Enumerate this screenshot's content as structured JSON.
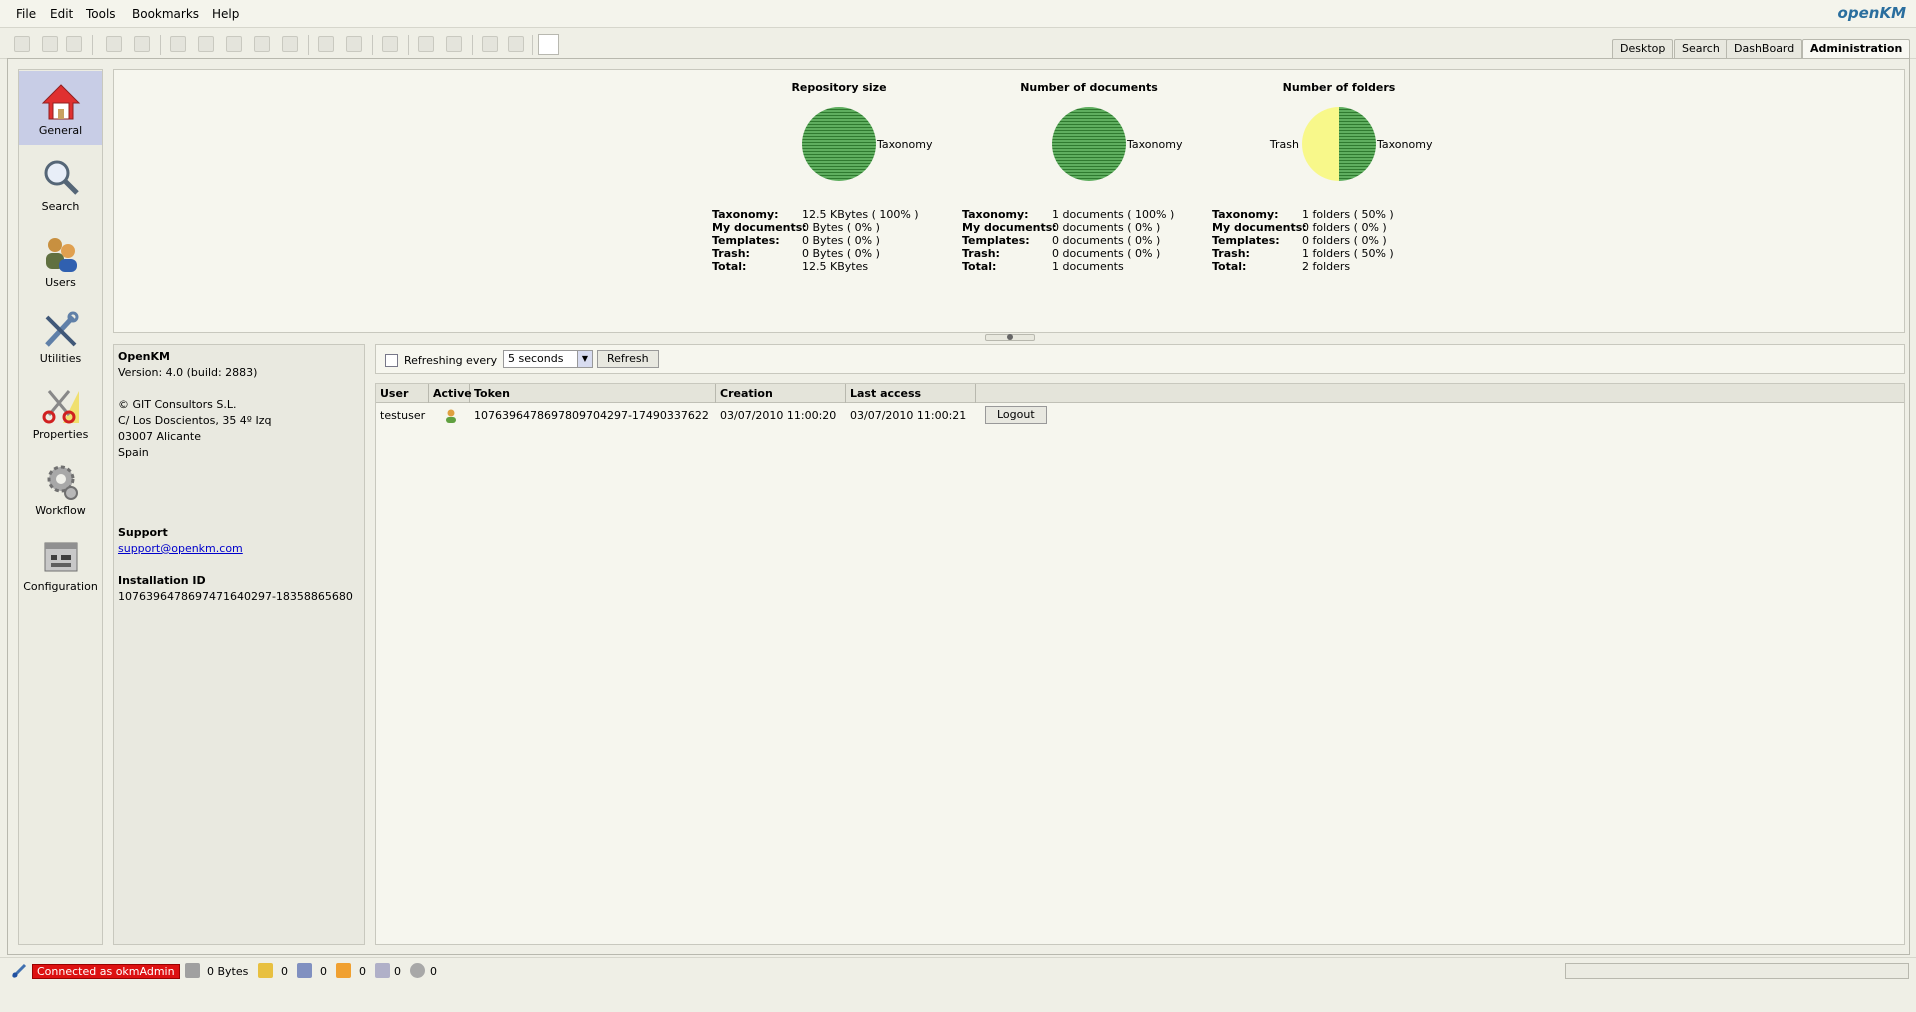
{
  "menu": [
    "File",
    "Edit",
    "Tools",
    "Bookmarks",
    "Help"
  ],
  "logo": {
    "main": "openKM"
  },
  "tabs": [
    "Desktop",
    "Search",
    "DashBoard",
    "Administration"
  ],
  "active_tab": "Administration",
  "nav": [
    {
      "label": "General",
      "icon": "home-icon",
      "active": true
    },
    {
      "label": "Search",
      "icon": "magnifier-icon"
    },
    {
      "label": "Users",
      "icon": "users-icon"
    },
    {
      "label": "Utilities",
      "icon": "tools-icon"
    },
    {
      "label": "Properties",
      "icon": "scissors-icon"
    },
    {
      "label": "Workflow",
      "icon": "gears-icon"
    },
    {
      "label": "Configuration",
      "icon": "server-icon"
    }
  ],
  "stats": [
    {
      "title": "Repository size",
      "pie": [
        {
          "label": "Taxonomy",
          "value": 100,
          "color": "#5fae5f"
        }
      ],
      "rows": [
        {
          "label": "Taxonomy:",
          "value": "12.5 KBytes ( 100% )"
        },
        {
          "label": "My documents:",
          "value": "0 Bytes ( 0% )"
        },
        {
          "label": "Templates:",
          "value": "0 Bytes ( 0% )"
        },
        {
          "label": "Trash:",
          "value": "0 Bytes ( 0% )"
        },
        {
          "label": "Total:",
          "value": "12.5 KBytes"
        }
      ]
    },
    {
      "title": "Number of documents",
      "pie": [
        {
          "label": "Taxonomy",
          "value": 100,
          "color": "#5fae5f"
        }
      ],
      "rows": [
        {
          "label": "Taxonomy:",
          "value": "1 documents ( 100% )"
        },
        {
          "label": "My documents:",
          "value": "0 documents ( 0% )"
        },
        {
          "label": "Templates:",
          "value": "0 documents ( 0% )"
        },
        {
          "label": "Trash:",
          "value": "0 documents ( 0% )"
        },
        {
          "label": "Total:",
          "value": "1 documents"
        }
      ]
    },
    {
      "title": "Number of folders",
      "pie": [
        {
          "label": "Taxonomy",
          "value": 50,
          "color": "#5fae5f"
        },
        {
          "label": "Trash",
          "value": 50,
          "color": "#f8f88a"
        }
      ],
      "rows": [
        {
          "label": "Taxonomy:",
          "value": "1 folders ( 50% )"
        },
        {
          "label": "My documents:",
          "value": "0 folders ( 0% )"
        },
        {
          "label": "Templates:",
          "value": "0 folders ( 0% )"
        },
        {
          "label": "Trash:",
          "value": "1 folders ( 50% )"
        },
        {
          "label": "Total:",
          "value": "2 folders"
        }
      ]
    }
  ],
  "info": {
    "product": "OpenKM",
    "version": "Version: 4.0 (build: 2883)",
    "company": "© GIT Consultors S.L.",
    "address1": "C/ Los Doscientos, 35 4º Izq",
    "address2": "03007 Alicante",
    "country": "Spain",
    "support_label": "Support",
    "support_email": "support@openkm.com",
    "install_label": "Installation ID",
    "install_id": "1076396478697471640297-18358865680"
  },
  "refresh": {
    "label": "Refreshing every",
    "interval": "5 seconds",
    "button": "Refresh"
  },
  "sessions": {
    "columns": [
      "User",
      "Active",
      "Token",
      "Creation",
      "Last access"
    ],
    "rows": [
      {
        "user": "testuser",
        "token": "1076396478697809704297-17490337622",
        "creation": "03/07/2010 11:00:20",
        "last_access": "03/07/2010 11:00:21",
        "action": "Logout"
      }
    ]
  },
  "status": {
    "connected": "Connected as okmAdmin",
    "size": "0 Bytes",
    "locked": "0",
    "checkout": "0",
    "mail": "0",
    "subscriptions": "0",
    "workflow": "0"
  }
}
